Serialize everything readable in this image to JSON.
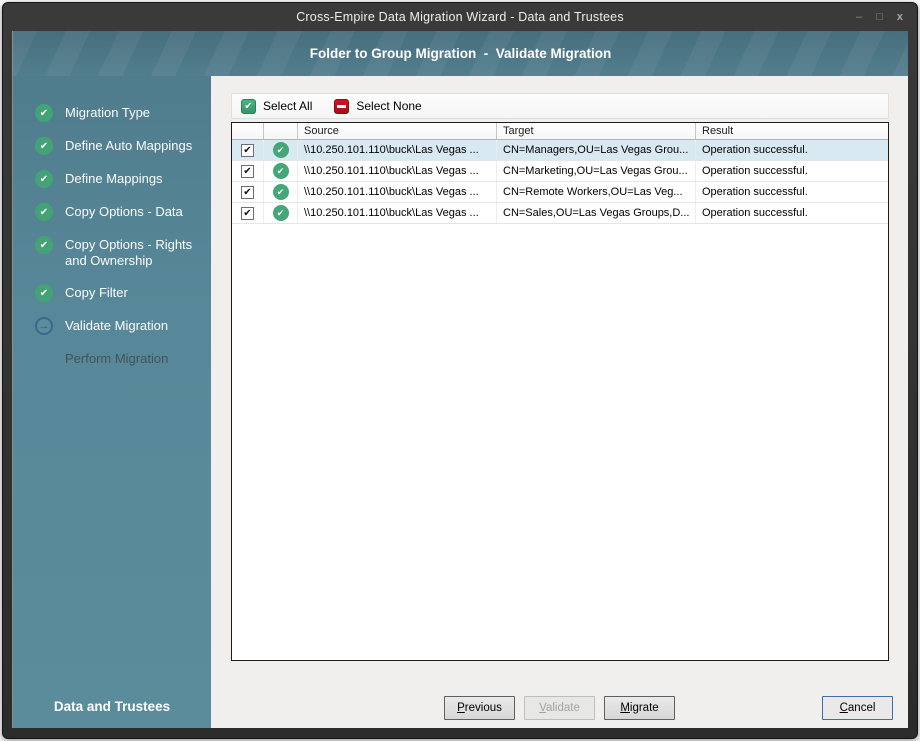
{
  "window": {
    "title": "Cross-Empire Data Migration Wizard - Data and Trustees",
    "controls": {
      "minimize": "–",
      "maximize": "□",
      "close": "x"
    }
  },
  "header": {
    "title": "Folder to Group Migration  -  Validate Migration"
  },
  "sidebar": {
    "steps": [
      {
        "label": "Migration Type",
        "status": "done"
      },
      {
        "label": "Define Auto Mappings",
        "status": "done"
      },
      {
        "label": "Define Mappings",
        "status": "done"
      },
      {
        "label": "Copy Options - Data",
        "status": "done"
      },
      {
        "label": "Copy Options - Rights and Ownership",
        "status": "done"
      },
      {
        "label": "Copy Filter",
        "status": "done"
      },
      {
        "label": "Validate Migration",
        "status": "current"
      },
      {
        "label": "Perform Migration",
        "status": "pending"
      }
    ],
    "footer": "Data and Trustees"
  },
  "toolbar": {
    "select_all": "Select All",
    "select_none": "Select None"
  },
  "icons": {
    "check": "✔",
    "checkbox_check": "✔",
    "arrow": "→"
  },
  "table": {
    "columns": [
      "Source",
      "Target",
      "Result"
    ],
    "rows": [
      {
        "checked": true,
        "selected": true,
        "source": "\\\\10.250.101.110\\buck\\Las Vegas ...",
        "target": "CN=Managers,OU=Las Vegas Grou...",
        "result": "Operation successful."
      },
      {
        "checked": true,
        "selected": false,
        "source": "\\\\10.250.101.110\\buck\\Las Vegas ...",
        "target": "CN=Marketing,OU=Las Vegas Grou...",
        "result": "Operation successful."
      },
      {
        "checked": true,
        "selected": false,
        "source": "\\\\10.250.101.110\\buck\\Las Vegas ...",
        "target": "CN=Remote Workers,OU=Las Veg...",
        "result": "Operation successful."
      },
      {
        "checked": true,
        "selected": false,
        "source": "\\\\10.250.101.110\\buck\\Las Vegas ...",
        "target": "CN=Sales,OU=Las Vegas Groups,D...",
        "result": "Operation successful."
      }
    ]
  },
  "buttons": {
    "previous": "Previous",
    "validate": "Validate",
    "migrate": "Migrate",
    "cancel": "Cancel"
  },
  "colors": {
    "sidebar_teal": "#578899",
    "header_teal": "#4c7888",
    "step_done_green": "#43a376",
    "status_success_green": "#45a678",
    "select_none_red": "#c0121f",
    "selected_row_blue": "#d8e9f2",
    "focus_border_blue": "#3d6fa5",
    "titlebar_dark": "#2f2f2f"
  }
}
